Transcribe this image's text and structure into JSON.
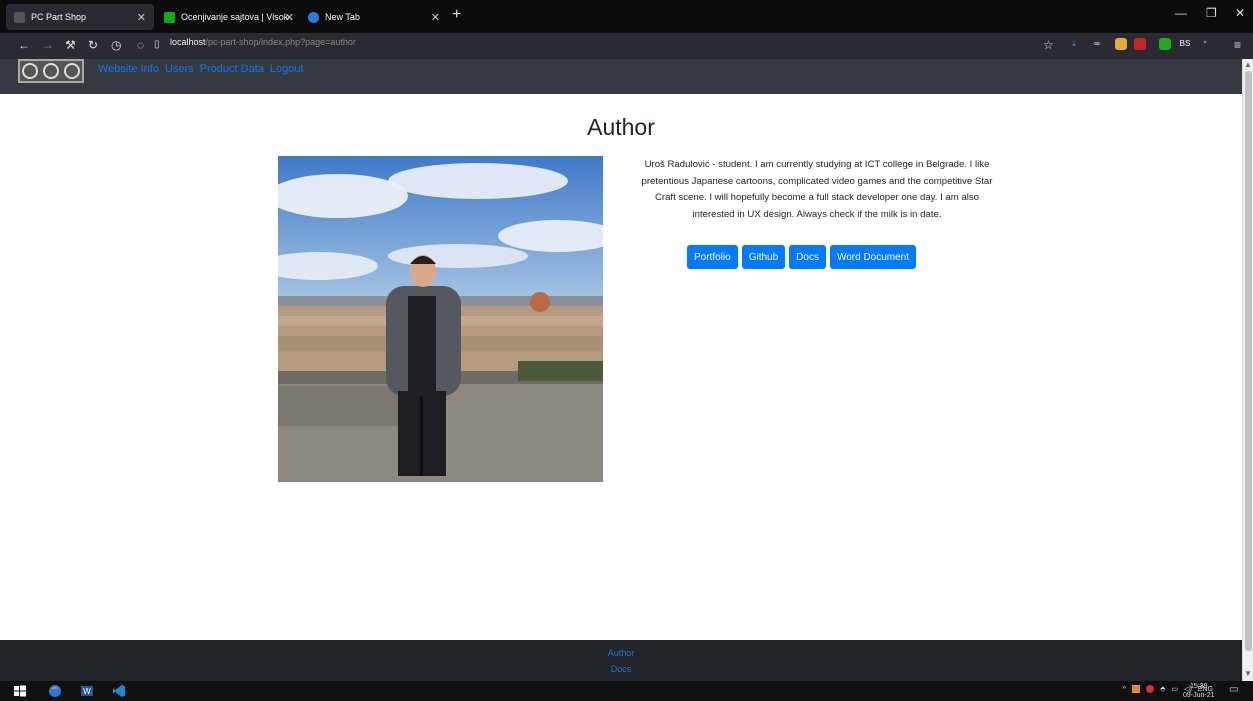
{
  "browser": {
    "tabs": [
      {
        "title": "PC Part Shop",
        "active": true
      },
      {
        "title": "Ocenjivanje sajtova | Visoka ICT",
        "active": false
      },
      {
        "title": "New Tab",
        "active": false
      }
    ],
    "url_host": "localhost",
    "url_path": "/pc-part-shop/index.php?page=author"
  },
  "site": {
    "nav_links": [
      "Website Info",
      "Users",
      "Product Data",
      "Logout"
    ]
  },
  "page": {
    "title": "Author",
    "bio": "Uroš Radulović - student. I am currently studying at ICT college in Belgrade. I like pretentious Japanese cartoons, complicated video games and the competitive Star Craft scene. I will hopefully become a full stack developer one day. I am also interested in UX design. Always check if the milk is in date.",
    "buttons": [
      "Portfolio",
      "Github",
      "Docs",
      "Word Document"
    ]
  },
  "footer": {
    "links": [
      "Author",
      "Docs"
    ]
  },
  "taskbar": {
    "lang": "ENG",
    "time": "15:39",
    "date": "09-Jun-21"
  },
  "colors": {
    "accent": "#007bff",
    "nav_bg": "#343a40",
    "footer_bg": "#212529"
  }
}
